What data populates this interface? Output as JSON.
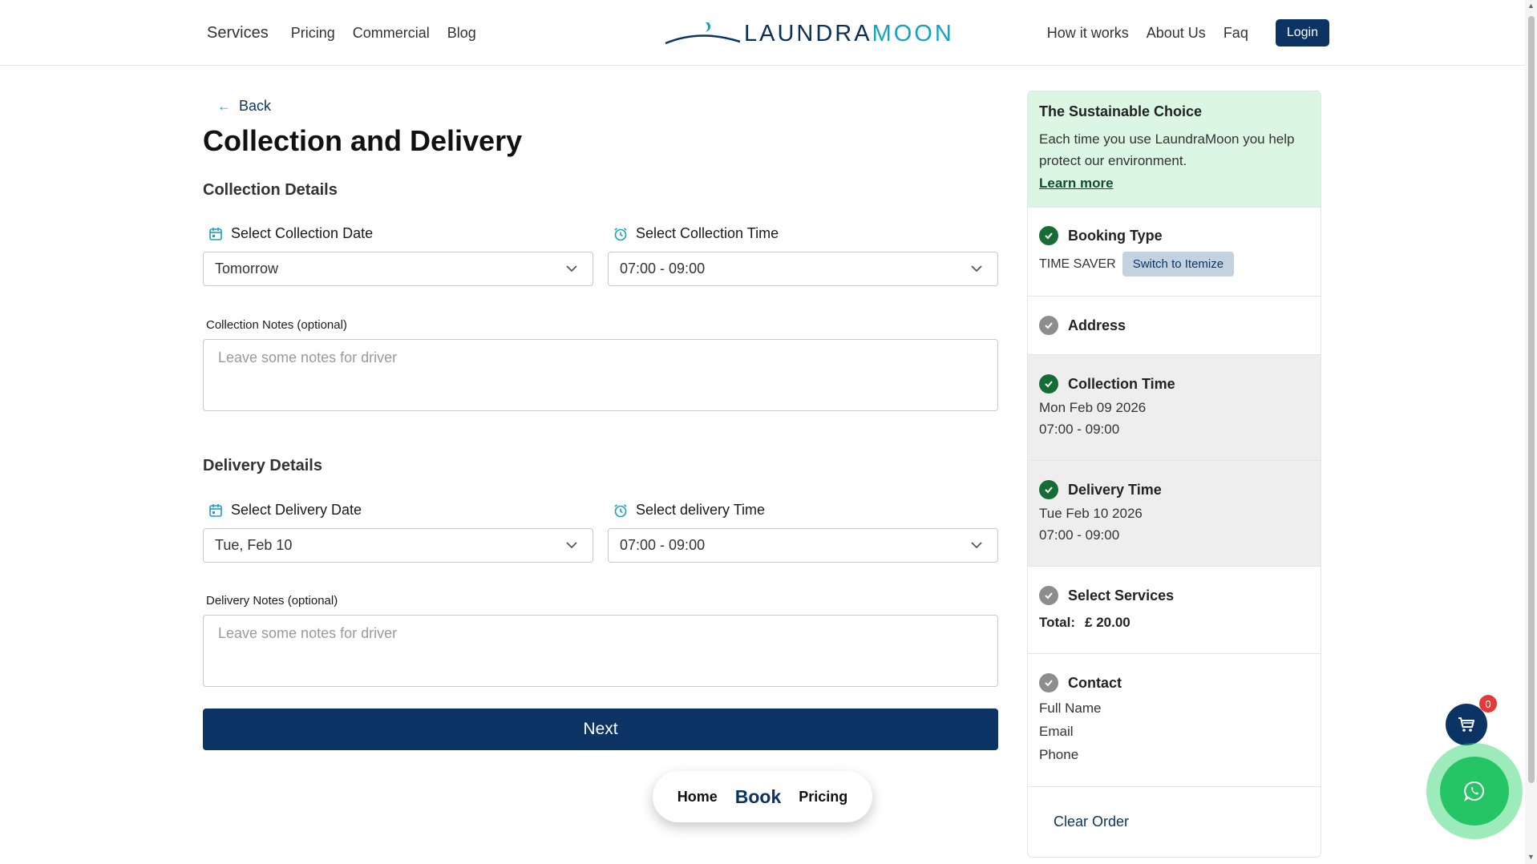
{
  "header": {
    "nav_left": [
      "Services",
      "Pricing",
      "Commercial",
      "Blog"
    ],
    "logo": {
      "part1": "LAUNDRA",
      "part2": "MOON"
    },
    "nav_right": [
      "How it works",
      "About Us",
      "Faq"
    ],
    "login_label": "Login"
  },
  "main": {
    "back_label": "Back",
    "title": "Collection and Delivery",
    "collection": {
      "section_title": "Collection Details",
      "date_label": "Select Collection Date",
      "date_value": "Tomorrow",
      "time_label": "Select Collection Time",
      "time_value": "07:00 - 09:00",
      "notes_label": "Collection Notes (optional)",
      "notes_placeholder": "Leave some notes for driver"
    },
    "delivery": {
      "section_title": "Delivery Details",
      "date_label": "Select Delivery Date",
      "date_value": "Tue, Feb 10",
      "time_label": "Select delivery Time",
      "time_value": "07:00 - 09:00",
      "notes_label": "Delivery Notes (optional)",
      "notes_placeholder": "Leave some notes for driver"
    },
    "next_label": "Next"
  },
  "bottom_nav": {
    "home": "Home",
    "book": "Book",
    "pricing": "Pricing"
  },
  "sidebar": {
    "promo": {
      "title": "The Sustainable Choice",
      "text": "Each time you use LaundraMoon you help protect our environment.",
      "link": "Learn more"
    },
    "booking_type": {
      "title": "Booking Type",
      "type": "TIME SAVER",
      "switch_label": "Switch to Itemize"
    },
    "address": {
      "title": "Address"
    },
    "collection_time": {
      "title": "Collection Time",
      "date": "Mon Feb 09 2026",
      "time": "07:00 - 09:00"
    },
    "delivery_time": {
      "title": "Delivery Time",
      "date": "Tue Feb 10 2026",
      "time": "07:00 - 09:00"
    },
    "services": {
      "title": "Select Services",
      "total_label": "Total:",
      "total_value": "£ 20.00"
    },
    "contact": {
      "title": "Contact",
      "fields": [
        "Full Name",
        "Email",
        "Phone"
      ]
    },
    "clear_label": "Clear Order"
  },
  "cart": {
    "count": "0"
  },
  "colors": {
    "brand_navy": "#0b3464",
    "accent_teal": "#16a2c7",
    "success_green": "#156d35",
    "promo_bg": "#dbf7e4",
    "whatsapp": "#25c565"
  }
}
